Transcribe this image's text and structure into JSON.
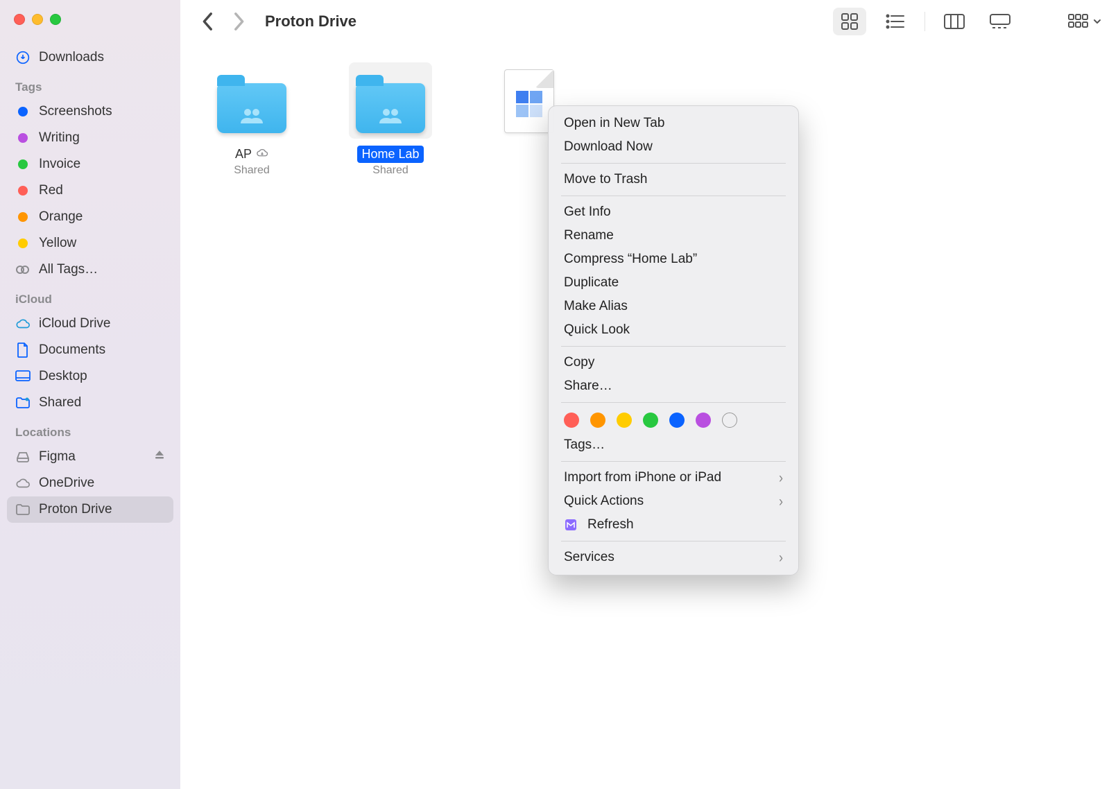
{
  "window_title": "Proton Drive",
  "sidebar": {
    "top_items": [
      {
        "label": "Downloads",
        "icon": "download-circle",
        "color": "#0a63ff"
      }
    ],
    "tags_header": "Tags",
    "tags": [
      {
        "label": "Screenshots",
        "color": "#0a63ff"
      },
      {
        "label": "Writing",
        "color": "#b94fe0"
      },
      {
        "label": "Invoice",
        "color": "#28c840"
      },
      {
        "label": "Red",
        "color": "#ff5f57"
      },
      {
        "label": "Orange",
        "color": "#ff9500"
      },
      {
        "label": "Yellow",
        "color": "#ffcc00"
      }
    ],
    "all_tags_label": "All Tags…",
    "icloud_header": "iCloud",
    "icloud": [
      {
        "label": "iCloud Drive",
        "icon": "cloud"
      },
      {
        "label": "Documents",
        "icon": "doc"
      },
      {
        "label": "Desktop",
        "icon": "desktop"
      },
      {
        "label": "Shared",
        "icon": "shared-folder"
      }
    ],
    "locations_header": "Locations",
    "locations": [
      {
        "label": "Figma",
        "icon": "disk",
        "eject": true
      },
      {
        "label": "OneDrive",
        "icon": "cloud-outline"
      },
      {
        "label": "Proton Drive",
        "icon": "folder",
        "active": true
      }
    ]
  },
  "items": [
    {
      "name": "AP",
      "subtitle": "Shared",
      "type": "shared-folder",
      "cloud": true,
      "selected": false
    },
    {
      "name": "Home Lab",
      "subtitle": "Shared",
      "type": "shared-folder",
      "cloud": false,
      "selected": true
    },
    {
      "name": "",
      "subtitle": "",
      "type": "file",
      "cloud": false,
      "selected": false
    }
  ],
  "context_menu": {
    "groups": [
      [
        "Open in New Tab",
        "Download Now"
      ],
      [
        "Move to Trash"
      ],
      [
        "Get Info",
        "Rename",
        "Compress “Home Lab”",
        "Duplicate",
        "Make Alias",
        "Quick Look"
      ],
      [
        "Copy",
        "Share…"
      ]
    ],
    "tag_colors": [
      "#ff5f57",
      "#ff9500",
      "#ffcc00",
      "#28c840",
      "#0a63ff",
      "#b94fe0",
      "transparent"
    ],
    "tags_label": "Tags…",
    "submenu_rows": [
      {
        "label": "Import from iPhone or iPad",
        "chevron": true
      },
      {
        "label": "Quick Actions",
        "chevron": true
      },
      {
        "label": "Refresh",
        "icon": "proton",
        "chevron": false
      }
    ],
    "services_label": "Services"
  }
}
